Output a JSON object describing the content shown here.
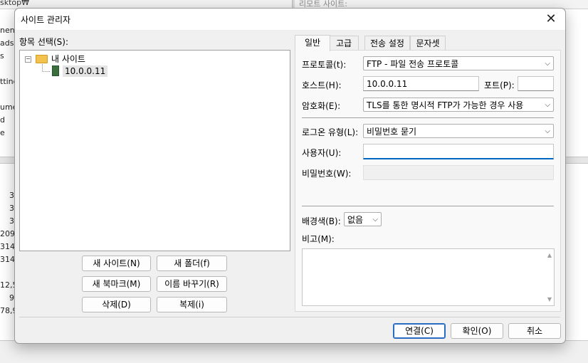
{
  "background": {
    "left_path": "sktop₩",
    "right_path": "리모트 사이트:",
    "left_items": [
      "nents",
      "ads",
      "s",
      "",
      "tting",
      "",
      "ume",
      "d",
      "e"
    ],
    "numbers": [
      "3",
      "3",
      "3",
      "209,",
      "314,",
      "314,",
      "",
      "12,5",
      "9",
      "78,9"
    ]
  },
  "dialog": {
    "title": "사이트 관리자",
    "close_glyph": "✕",
    "select_entry_label": "항목 선택(S):",
    "tree": {
      "expander": "−",
      "root_label": "내 사이트",
      "child_label": "10.0.0.11"
    },
    "buttons": {
      "new_site": "새 사이트(N)",
      "new_folder": "새 폴더(f)",
      "new_bookmark": "새 북마크(M)",
      "rename": "이름 바꾸기(R)",
      "delete": "삭제(D)",
      "duplicate": "복제(i)"
    },
    "tabs": [
      "일반",
      "고급",
      "전송 설정",
      "문자셋"
    ],
    "general": {
      "protocol_label": "프로토콜(t):",
      "protocol_value": "FTP - 파일 전송 프로토콜",
      "host_label": "호스트(H):",
      "host_value": "10.0.0.11",
      "port_label": "포트(P):",
      "port_value": "",
      "encryption_label": "암호화(E):",
      "encryption_value": "TLS를 통한 명시적 FTP가 가능한 경우 사용",
      "logon_type_label": "로그온 유형(L):",
      "logon_type_value": "비밀번호 묻기",
      "user_label": "사용자(U):",
      "user_value": "",
      "password_label": "비밀번호(W):",
      "background_color_label": "배경색(B):",
      "background_color_value": "없음",
      "comments_label": "비고(M):"
    },
    "footer": {
      "connect": "연결(C)",
      "ok": "확인(O)",
      "cancel": "취소"
    }
  },
  "icons": {
    "chevron": "⌵",
    "scroll_up": "▲",
    "scroll_down": "▼"
  }
}
